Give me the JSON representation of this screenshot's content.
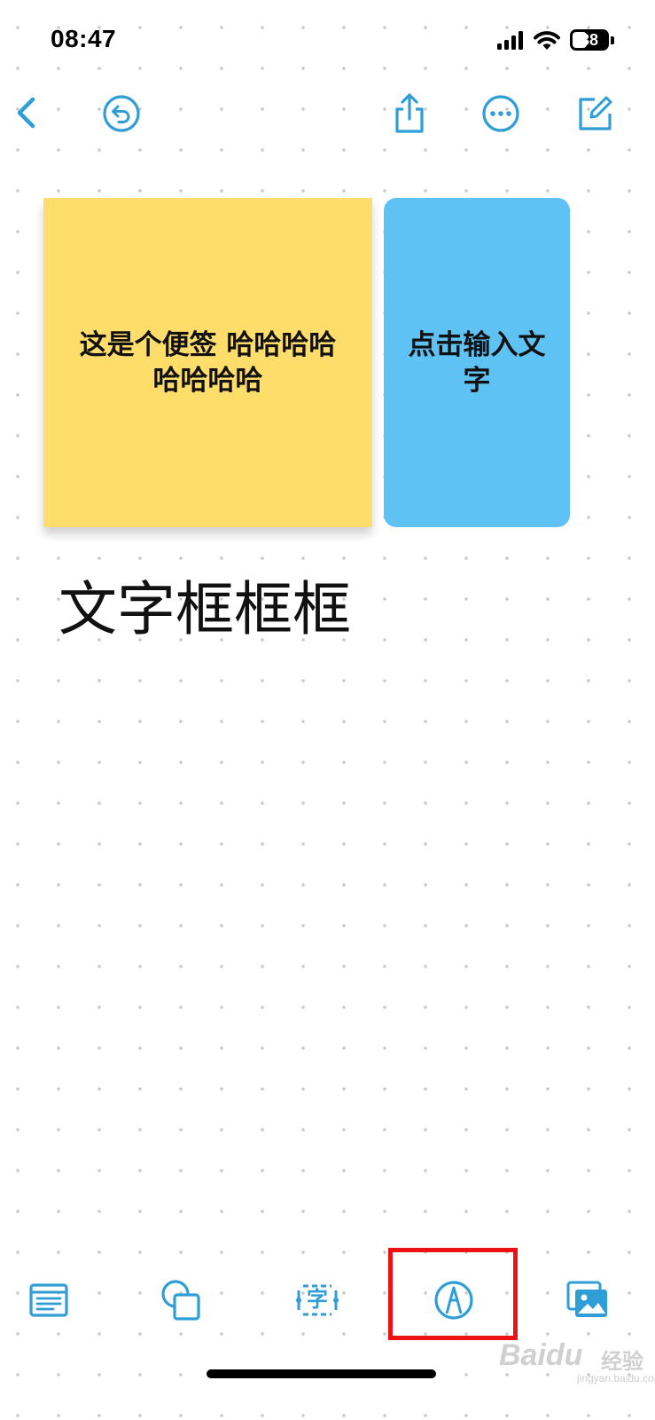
{
  "status_bar": {
    "time": "08:47",
    "battery_level": "38"
  },
  "toolbar": {
    "icons": [
      "chevron-left-icon",
      "undo-icon",
      "share-icon",
      "more-icon",
      "compose-icon"
    ]
  },
  "board": {
    "sticky_notes": [
      {
        "text": "这是个便签 哈哈哈哈 哈哈哈哈",
        "color": "#ffdd6b"
      },
      {
        "text": "点击输入文字",
        "color": "#5ec2f5"
      }
    ],
    "text_box": "文字框框框"
  },
  "bottom_toolbar": {
    "icons": [
      "sticky-note-icon",
      "shapes-icon",
      "text-box-icon",
      "pen-tool-icon",
      "media-icon"
    ],
    "text_box_glyph": "字",
    "highlighted_tool": "pen-tool-icon",
    "highlight_color": "#ee1111"
  },
  "accent_color": "#2f9ed6",
  "watermark": {
    "main": "Baidu",
    "cn": "经验",
    "sub": "jingyan.baidu.com"
  }
}
